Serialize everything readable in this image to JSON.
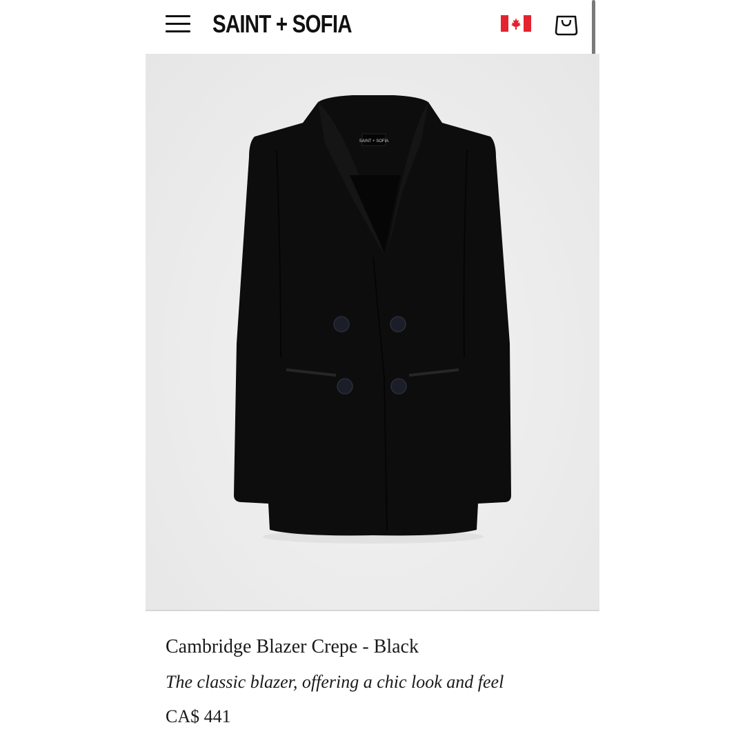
{
  "header": {
    "brand": "SAINT + SOFIA",
    "menu_icon": "hamburger-menu-icon",
    "country_flag_icon": "canada-flag-icon",
    "cart_icon": "shopping-bag-icon"
  },
  "product": {
    "image_subject": "black double-breasted blazer",
    "label_text": "SAINT + SOFIA",
    "name": "Cambridge Blazer Crepe - Black",
    "tagline": "The classic blazer, offering a chic look and feel",
    "price": "CA$ 441"
  },
  "colors": {
    "flag_red": "#e4232f",
    "blazer": "#0d0d0d",
    "hero_bg": "#ececec"
  }
}
